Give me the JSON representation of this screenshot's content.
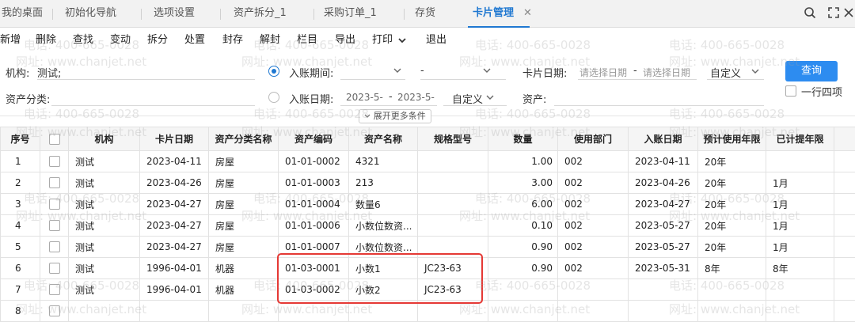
{
  "tabs": [
    {
      "label": "我的桌面"
    },
    {
      "label": "初始化导航"
    },
    {
      "label": "选项设置"
    },
    {
      "label": "资产拆分_1"
    },
    {
      "label": "采购订单_1"
    },
    {
      "label": "存货"
    },
    {
      "label": "卡片管理",
      "close": "✕"
    }
  ],
  "top_icons": [
    "search-icon",
    "fullscreen-icon",
    "close-icon"
  ],
  "toolbar": [
    "新增",
    "删除",
    "查找",
    "变动",
    "拆分",
    "处置",
    "封存",
    "解封",
    "栏目",
    "导出",
    "打印",
    "退出"
  ],
  "filters": {
    "org_label": "机构:",
    "org_value": "测试;",
    "asset_class_label": "资产分类:",
    "post_period_label": "入账期间:",
    "post_period_dash": "-",
    "post_date_label": "入账日期:",
    "post_date_from": "2023-5-",
    "post_date_sep": "-",
    "post_date_to": "2023-5-",
    "post_date_mode": "自定义",
    "card_date_label": "卡片日期:",
    "card_date_from_placeholder": "请选择日期",
    "card_date_sep": "-",
    "card_date_to_placeholder": "请选择日期",
    "card_date_mode": "自定义",
    "asset_label": "资产:",
    "query_button": "查询",
    "four_items_label": "一行四项",
    "expand_label": "展开更多条件"
  },
  "table": {
    "headers": [
      "序号",
      "",
      "机构",
      "卡片日期",
      "资产分类名称",
      "资产编码",
      "资产名称",
      "规格型号",
      "数量",
      "使用部门",
      "入账日期",
      "预计使用年限",
      "已计提年限"
    ],
    "rows": [
      {
        "no": "1",
        "org": "测试",
        "card_date": "2023-04-11",
        "cls": "房屋",
        "code": "01-01-0002",
        "name": "4321",
        "spec": "",
        "qty": "1.00",
        "dept": "002",
        "post_date": "2023-04-11",
        "life": "20年",
        "depr": ""
      },
      {
        "no": "2",
        "org": "测试",
        "card_date": "2023-04-26",
        "cls": "房屋",
        "code": "01-01-0003",
        "name": "213",
        "spec": "",
        "qty": "3.00",
        "dept": "002",
        "post_date": "2023-04-26",
        "life": "20年",
        "depr": "1月"
      },
      {
        "no": "3",
        "org": "测试",
        "card_date": "2023-04-27",
        "cls": "房屋",
        "code": "01-01-0004",
        "name": "数量6",
        "spec": "",
        "qty": "6.00",
        "dept": "002",
        "post_date": "2023-04-27",
        "life": "20年",
        "depr": "1月"
      },
      {
        "no": "4",
        "org": "测试",
        "card_date": "2023-04-27",
        "cls": "房屋",
        "code": "01-01-0006",
        "name": "小数位数资...",
        "spec": "",
        "qty": "0.10",
        "dept": "002",
        "post_date": "2023-05-27",
        "life": "20年",
        "depr": "1月"
      },
      {
        "no": "5",
        "org": "测试",
        "card_date": "2023-04-27",
        "cls": "房屋",
        "code": "01-01-0007",
        "name": "小数位数资...",
        "spec": "",
        "qty": "0.90",
        "dept": "002",
        "post_date": "2023-05-27",
        "life": "20年",
        "depr": "1月"
      },
      {
        "no": "6",
        "org": "测试",
        "card_date": "1996-04-01",
        "cls": "机器",
        "code": "01-03-0001",
        "name": "小数1",
        "spec": "JC23-63",
        "qty": "0.90",
        "dept": "002",
        "post_date": "2023-05-31",
        "life": "8年",
        "depr": "8年"
      },
      {
        "no": "7",
        "org": "测试",
        "card_date": "1996-04-01",
        "cls": "机器",
        "code": "01-03-0002",
        "name": "小数2",
        "spec": "JC23-63",
        "qty": "",
        "dept": "",
        "post_date": "",
        "life": "",
        "depr": ""
      },
      {
        "no": "8",
        "org": "",
        "card_date": "",
        "cls": "",
        "code": "",
        "name": "",
        "spec": "",
        "qty": "",
        "dept": "",
        "post_date": "",
        "life": "",
        "depr": ""
      }
    ]
  },
  "watermark": {
    "phone": "电话: 400-665-0028",
    "site": "网址: www.chanjet.net"
  }
}
